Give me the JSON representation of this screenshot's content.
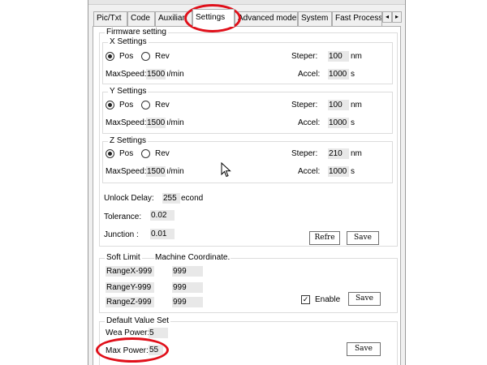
{
  "tabs": [
    {
      "label": "Pic/Txt"
    },
    {
      "label": "Code"
    },
    {
      "label": "Auxiliar"
    },
    {
      "label": "Settings"
    },
    {
      "label": "Advanced model"
    },
    {
      "label": "System"
    },
    {
      "label": "Fast Process"
    }
  ],
  "scroll_left": "◂",
  "scroll_right": "▸",
  "firmware": {
    "title": "Firmware setting",
    "x": {
      "title": "X Settings",
      "pos": "Pos",
      "rev": "Rev",
      "steper_label": "Steper:",
      "steper_value": "100",
      "steper_unit": "nm",
      "maxspeed_label": "MaxSpeed:",
      "maxspeed_value": "1500",
      "maxspeed_unit": "ı/min",
      "accel_label": "Accel:",
      "accel_value": "1000",
      "accel_unit": "s"
    },
    "y": {
      "title": "Y Settings",
      "pos": "Pos",
      "rev": "Rev",
      "steper_label": "Steper:",
      "steper_value": "100",
      "steper_unit": "nm",
      "maxspeed_label": "MaxSpeed:",
      "maxspeed_value": "1500",
      "maxspeed_unit": "ı/min",
      "accel_label": "Accel:",
      "accel_value": "1000",
      "accel_unit": "s"
    },
    "z": {
      "title": "Z Settings",
      "pos": "Pos",
      "rev": "Rev",
      "steper_label": "Steper:",
      "steper_value": "210",
      "steper_unit": "nm",
      "maxspeed_label": "MaxSpeed:",
      "maxspeed_value": "1500",
      "maxspeed_unit": "ı/min",
      "accel_label": "Accel:",
      "accel_value": "1000",
      "accel_unit": "s"
    },
    "unlock_delay_label": "Unlock Delay:",
    "unlock_delay_value": "255",
    "unlock_delay_unit": "econd",
    "tolerance_label": "Tolerance:",
    "tolerance_value": "0.02",
    "junction_label": "Junction :",
    "junction_value": "0.01",
    "refresh_label": "Refre",
    "save_label": "Save"
  },
  "soft_limit": {
    "title": "Soft Limit",
    "subtitle": "Machine Coordinate.",
    "rows": [
      {
        "label": "RangeX-999",
        "value": "999"
      },
      {
        "label": "RangeY-999",
        "value": "999"
      },
      {
        "label": "RangeZ-999",
        "value": "999"
      }
    ],
    "enable_label": "Enable",
    "enable_mark": "✓",
    "save_label": "Save"
  },
  "default_value": {
    "title": "Default Value Set",
    "wea_power_label": "Wea Power:",
    "wea_power_value": "5",
    "max_power_label": "Max Power:",
    "max_power_value": "55",
    "save_label": "Save"
  },
  "colors": {
    "highlight": "#e0101a",
    "field_bg": "#e8e8e8"
  }
}
